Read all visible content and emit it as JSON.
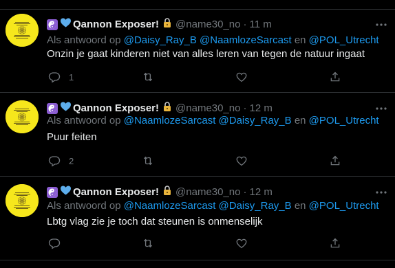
{
  "colors": {
    "background": "#000000",
    "text": "#e7e9ea",
    "muted": "#71767b",
    "link": "#1d9bf0",
    "avatar": "#f6e71c"
  },
  "tweets": [
    {
      "author": {
        "name": "Qannon Exposer!",
        "handle": "@name30_no",
        "badges": [
          "yin-yang-emoji",
          "blue-heart-emoji",
          "lock-emoji"
        ]
      },
      "time": "11 m",
      "separator": "·",
      "reply_prefix": "Als antwoord op",
      "mentions": [
        "@Daisy_Ray_B",
        "@NaamlozeSarcast"
      ],
      "reply_conjunction": "en",
      "mention_last": "@POL_Utrecht",
      "text": "Onzin je gaat kinderen niet van alles leren van tegen de natuur ingaat",
      "reply_count": "1"
    },
    {
      "author": {
        "name": "Qannon Exposer!",
        "handle": "@name30_no",
        "badges": [
          "yin-yang-emoji",
          "blue-heart-emoji",
          "lock-emoji"
        ]
      },
      "time": "12 m",
      "separator": "·",
      "reply_prefix": "Als antwoord op",
      "mentions": [
        "@NaamlozeSarcast",
        "@Daisy_Ray_B"
      ],
      "reply_conjunction": "en",
      "mention_last": "@POL_Utrecht",
      "text": "Puur feiten",
      "reply_count": "2"
    },
    {
      "author": {
        "name": "Qannon Exposer!",
        "handle": "@name30_no",
        "badges": [
          "yin-yang-emoji",
          "blue-heart-emoji",
          "lock-emoji"
        ]
      },
      "time": "12 m",
      "separator": "·",
      "reply_prefix": "Als antwoord op",
      "mentions": [
        "@NaamlozeSarcast",
        "@Daisy_Ray_B"
      ],
      "reply_conjunction": "en",
      "mention_last": "@POL_Utrecht",
      "text": "Lbtg vlag zie je toch dat steunen is onmenselijk",
      "reply_count": ""
    }
  ],
  "icons": {
    "reply": "reply-icon",
    "retweet": "retweet-icon",
    "like": "like-icon",
    "share": "share-icon",
    "more": "more-icon"
  }
}
